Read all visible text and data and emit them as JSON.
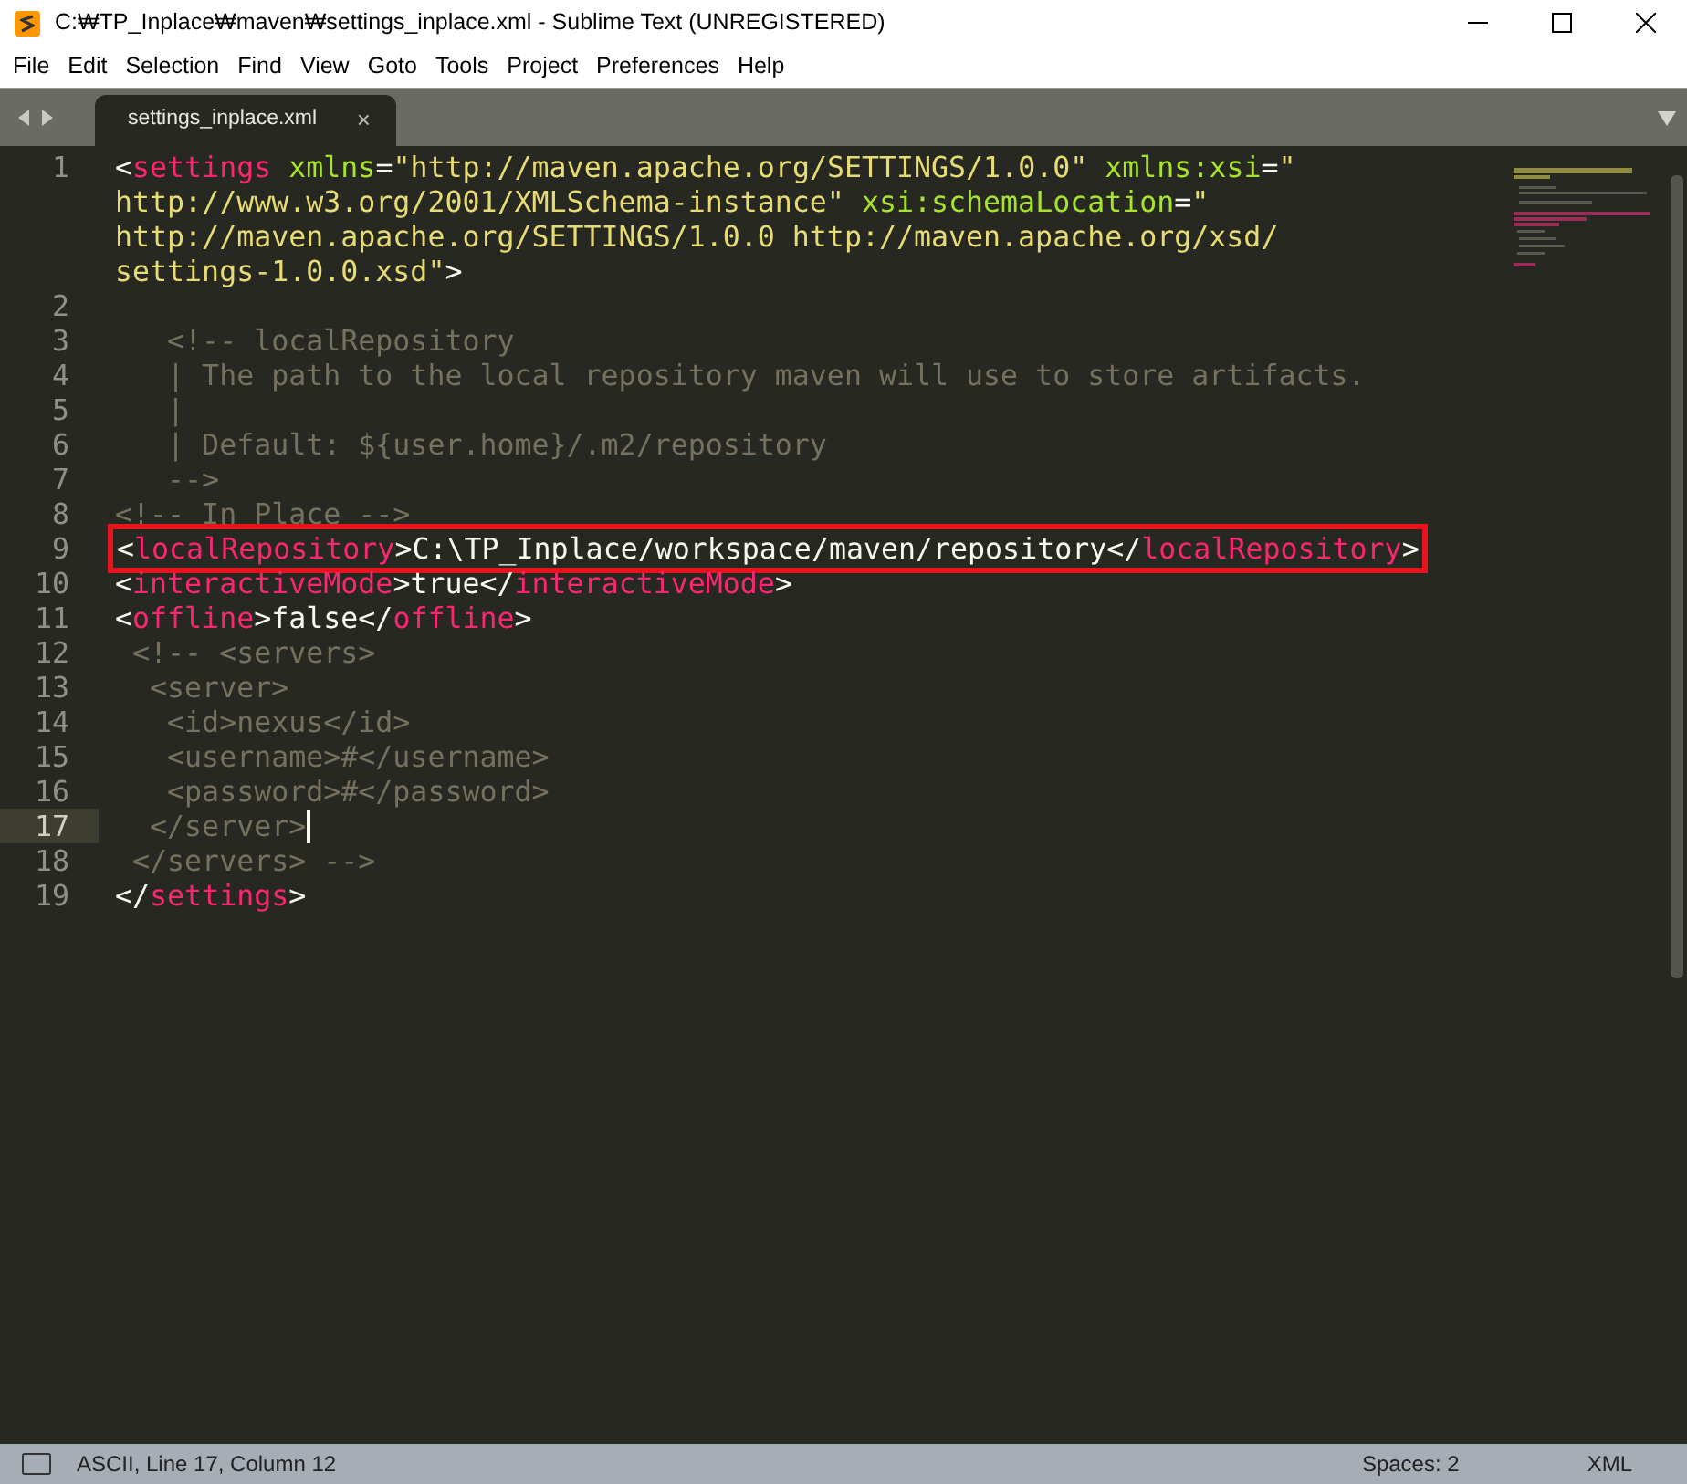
{
  "window": {
    "title": "C:₩TP_Inplace₩maven₩settings_inplace.xml - Sublime Text (UNREGISTERED)"
  },
  "menu": [
    "File",
    "Edit",
    "Selection",
    "Find",
    "View",
    "Goto",
    "Tools",
    "Project",
    "Preferences",
    "Help"
  ],
  "tabs": [
    {
      "label": "settings_inplace.xml",
      "selected": true,
      "close": "×"
    }
  ],
  "lines": [
    {
      "number": "1",
      "current": false,
      "highlighted": false,
      "rows": [
        {
          "segments": [
            {
              "kind": "p",
              "text": "<"
            },
            {
              "kind": "tag",
              "text": "settings"
            },
            {
              "kind": "attr",
              "text": " xmlns"
            },
            {
              "kind": "p",
              "text": "="
            },
            {
              "kind": "str",
              "text": "\"http://maven.apache.org/SETTINGS/1.0.0\""
            },
            {
              "kind": "attr",
              "text": " xmlns:xsi"
            },
            {
              "kind": "p",
              "text": "="
            },
            {
              "kind": "str",
              "text": "\""
            }
          ]
        },
        {
          "segments": [
            {
              "kind": "str",
              "text": "http://www.w3.org/2001/XMLSchema-instance\""
            },
            {
              "kind": "attr",
              "text": " xsi:schemaLocation"
            },
            {
              "kind": "p",
              "text": "="
            },
            {
              "kind": "str",
              "text": "\""
            }
          ]
        },
        {
          "segments": [
            {
              "kind": "str",
              "text": "http://maven.apache.org/SETTINGS/1.0.0 http://maven.apache.org/xsd/"
            }
          ]
        },
        {
          "segments": [
            {
              "kind": "str",
              "text": "settings-1.0.0.xsd\""
            },
            {
              "kind": "p",
              "text": ">"
            }
          ]
        }
      ]
    },
    {
      "number": "2",
      "current": false,
      "highlighted": false,
      "rows": [
        []
      ]
    },
    {
      "number": "3",
      "current": false,
      "highlighted": false,
      "rows": [
        [
          {
            "kind": "comment",
            "text": "   <!-- localRepository"
          }
        ]
      ]
    },
    {
      "number": "4",
      "current": false,
      "highlighted": false,
      "rows": [
        [
          {
            "kind": "comment",
            "text": "   | The path to the local repository maven will use to store artifacts."
          }
        ]
      ]
    },
    {
      "number": "5",
      "current": false,
      "highlighted": false,
      "rows": [
        [
          {
            "kind": "comment",
            "text": "   |"
          }
        ]
      ]
    },
    {
      "number": "6",
      "current": false,
      "highlighted": false,
      "rows": [
        [
          {
            "kind": "comment",
            "text": "   | Default: ${user.home}/.m2/repository"
          }
        ]
      ]
    },
    {
      "number": "7",
      "current": false,
      "highlighted": false,
      "rows": [
        [
          {
            "kind": "comment",
            "text": "   -->"
          }
        ]
      ]
    },
    {
      "number": "8",
      "current": false,
      "highlighted": false,
      "rows": [
        [
          {
            "kind": "comment",
            "text": "<!-- In Place -->"
          }
        ]
      ]
    },
    {
      "number": "9",
      "current": false,
      "highlighted": true,
      "rows": [
        [
          {
            "kind": "p",
            "text": "<"
          },
          {
            "kind": "tag",
            "text": "localRepository"
          },
          {
            "kind": "p",
            "text": ">C:\\TP_Inplace/workspace/maven/repository</"
          },
          {
            "kind": "tag",
            "text": "localRepository"
          },
          {
            "kind": "p",
            "text": ">"
          }
        ]
      ]
    },
    {
      "number": "10",
      "current": false,
      "highlighted": false,
      "rows": [
        [
          {
            "kind": "p",
            "text": "<"
          },
          {
            "kind": "tag",
            "text": "interactiveMode"
          },
          {
            "kind": "p",
            "text": ">true</"
          },
          {
            "kind": "tag",
            "text": "interactiveMode"
          },
          {
            "kind": "p",
            "text": ">"
          }
        ]
      ]
    },
    {
      "number": "11",
      "current": false,
      "highlighted": false,
      "rows": [
        [
          {
            "kind": "p",
            "text": "<"
          },
          {
            "kind": "tag",
            "text": "offline"
          },
          {
            "kind": "p",
            "text": ">false</"
          },
          {
            "kind": "tag",
            "text": "offline"
          },
          {
            "kind": "p",
            "text": ">"
          }
        ]
      ]
    },
    {
      "number": "12",
      "current": false,
      "highlighted": false,
      "rows": [
        [
          {
            "kind": "comment",
            "text": " <!-- <servers>"
          }
        ]
      ]
    },
    {
      "number": "13",
      "current": false,
      "highlighted": false,
      "rows": [
        [
          {
            "kind": "comment",
            "text": "  <server>"
          }
        ]
      ]
    },
    {
      "number": "14",
      "current": false,
      "highlighted": false,
      "rows": [
        [
          {
            "kind": "comment",
            "text": "   <id>nexus</id>"
          }
        ]
      ]
    },
    {
      "number": "15",
      "current": false,
      "highlighted": false,
      "rows": [
        [
          {
            "kind": "comment",
            "text": "   <username>#</username>"
          }
        ]
      ]
    },
    {
      "number": "16",
      "current": false,
      "highlighted": false,
      "rows": [
        [
          {
            "kind": "comment",
            "text": "   <password>#</password>"
          }
        ]
      ]
    },
    {
      "number": "17",
      "current": true,
      "highlighted": false,
      "rows": [
        [
          {
            "kind": "comment",
            "text": "  </server>"
          }
        ]
      ]
    },
    {
      "number": "18",
      "current": false,
      "highlighted": false,
      "rows": [
        [
          {
            "kind": "comment",
            "text": " </servers> -->"
          }
        ]
      ]
    },
    {
      "number": "19",
      "current": false,
      "highlighted": false,
      "rows": [
        [
          {
            "kind": "p",
            "text": "</"
          },
          {
            "kind": "tag",
            "text": "settings"
          },
          {
            "kind": "p",
            "text": ">"
          }
        ]
      ]
    }
  ],
  "status_bar": {
    "position": "ASCII, Line 17, Column 12",
    "indent": "Spaces: 2",
    "syntax": "XML"
  }
}
